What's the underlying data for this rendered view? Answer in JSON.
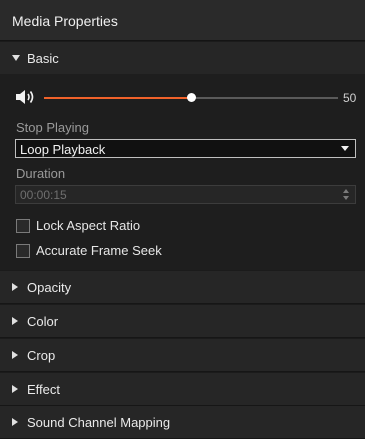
{
  "panel": {
    "title": "Media Properties"
  },
  "sections": {
    "basic": "Basic",
    "opacity": "Opacity",
    "color": "Color",
    "crop": "Crop",
    "effect": "Effect",
    "sound": "Sound Channel Mapping"
  },
  "volume": {
    "value": "50",
    "level": 0.5,
    "icon": "speaker-icon",
    "accent": "#f0622a"
  },
  "stop_playing": {
    "label": "Stop Playing",
    "selected": "Loop Playback"
  },
  "duration": {
    "label": "Duration",
    "value": "00:00:15"
  },
  "checkboxes": {
    "lock_aspect": "Lock Aspect Ratio",
    "accurate_seek": "Accurate Frame Seek"
  }
}
